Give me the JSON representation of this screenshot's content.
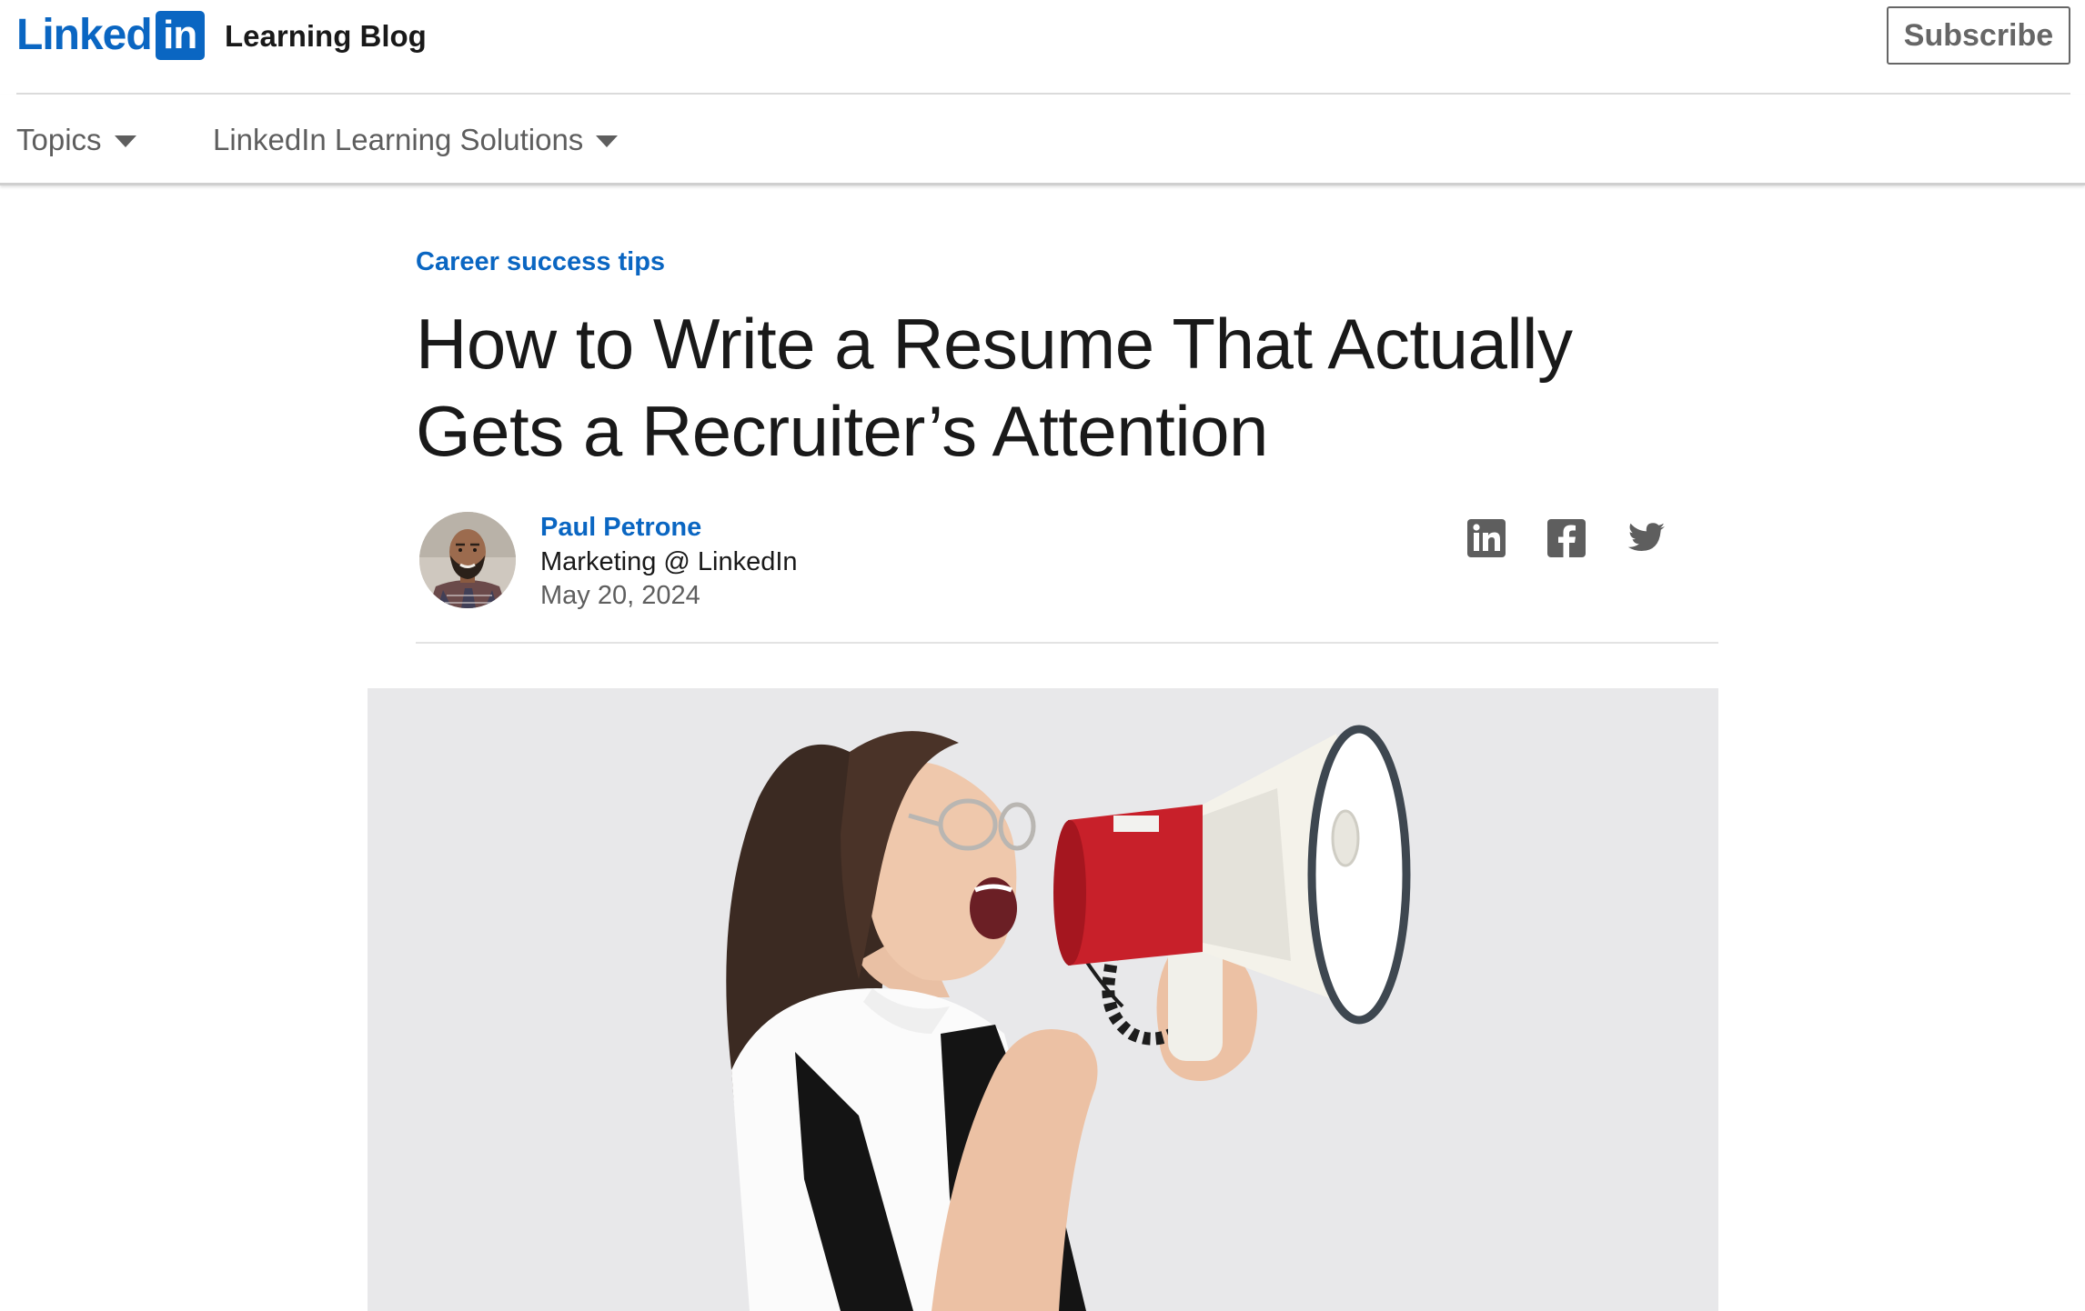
{
  "header": {
    "logo_word": "Linked",
    "logo_box": "in",
    "site_name": "Learning Blog",
    "subscribe_label": "Subscribe"
  },
  "nav": {
    "items": [
      {
        "label": "Topics",
        "icon": "caret-down-icon"
      },
      {
        "label": "LinkedIn Learning Solutions",
        "icon": "caret-down-icon"
      }
    ]
  },
  "article": {
    "category": "Career success tips",
    "title": "How to Write a Resume That Actually Gets a Recruiter’s Attention",
    "author": {
      "name": "Paul Petrone",
      "role": "Marketing @ LinkedIn",
      "date": "May 20, 2024"
    },
    "share_icons": [
      "linkedin-icon",
      "facebook-icon",
      "twitter-icon"
    ]
  },
  "colors": {
    "brand": "#0a66c2",
    "text": "#191919",
    "muted": "#5e5e5e",
    "megaphone_red": "#c8202a"
  }
}
